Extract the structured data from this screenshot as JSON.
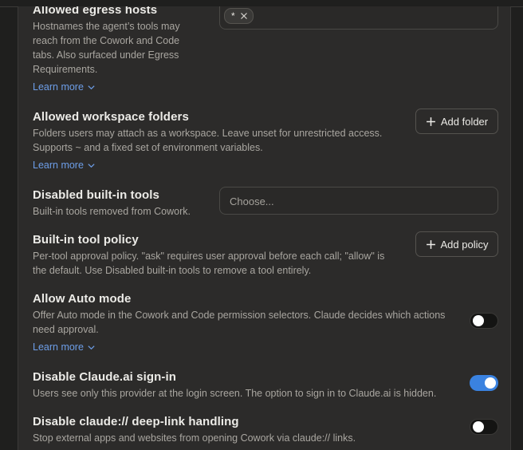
{
  "settings": {
    "egress": {
      "title": "Allowed egress hosts",
      "desc_lines": [
        "Hostnames the agent’s tools may",
        "reach from the Cowork and Code",
        "tabs. Also surfaced under Egress",
        "Requirements."
      ],
      "learn_more": "Learn more",
      "chip_value": "*"
    },
    "workspace": {
      "title": "Allowed workspace folders",
      "desc_lines": [
        "Folders users may attach as a workspace. Leave unset for unrestricted access.",
        "Supports ~ and a fixed set of environment variables."
      ],
      "learn_more": "Learn more",
      "button": "Add folder"
    },
    "disabled_tools": {
      "title": "Disabled built-in tools",
      "desc": "Built-in tools removed from Cowork.",
      "placeholder": "Choose..."
    },
    "tool_policy": {
      "title": "Built-in tool policy",
      "desc_lines": [
        "Per-tool approval policy. \"ask\" requires user approval before each call; \"allow\" is",
        "the default. Use Disabled built-in tools to remove a tool entirely."
      ],
      "button": "Add policy"
    },
    "auto_mode": {
      "title": "Allow Auto mode",
      "desc_lines": [
        "Offer Auto mode in the Cowork and Code permission selectors. Claude decides which actions",
        "need approval."
      ],
      "learn_more": "Learn more",
      "enabled": false
    },
    "claude_signin": {
      "title": "Disable Claude.ai sign-in",
      "desc": "Users see only this provider at the login screen. The option to sign in to Claude.ai is hidden.",
      "enabled": true
    },
    "deeplink": {
      "title": "Disable claude:// deep-link handling",
      "desc": "Stop external apps and websites from opening Cowork via claude:// links.",
      "enabled": false
    }
  },
  "colors": {
    "accent": "#3a82e0",
    "link": "#6d9ee8",
    "background": "#2c2b2a"
  },
  "icons": {
    "chevron": "chevron-down-icon",
    "plus": "plus-icon",
    "close": "close-icon"
  }
}
